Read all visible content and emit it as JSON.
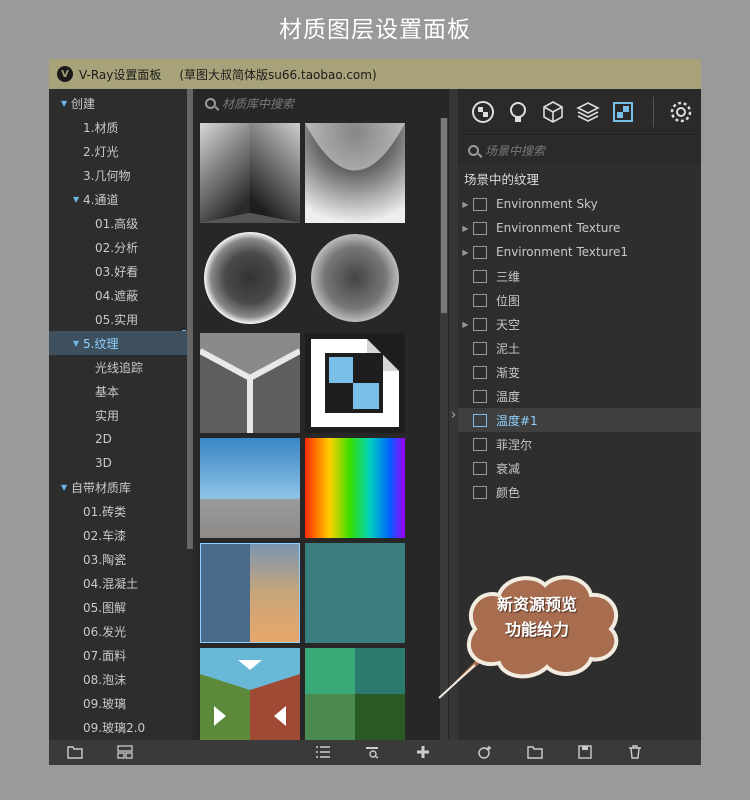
{
  "page_title": "材质图层设置面板",
  "window": {
    "logo": "V",
    "title": "V-Ray设置面板",
    "subtitle": "(草图大叔简体版su66.taobao.com)"
  },
  "tree": {
    "items": [
      {
        "label": "创建",
        "caret": "▼"
      },
      {
        "label": "1.材质"
      },
      {
        "label": "2.灯光"
      },
      {
        "label": "3.几何物"
      },
      {
        "label": "4.通道",
        "caret": "▼"
      },
      {
        "label": "01.高级"
      },
      {
        "label": "02.分析"
      },
      {
        "label": "03.好看"
      },
      {
        "label": "04.遮蔽"
      },
      {
        "label": "05.实用"
      },
      {
        "label": "5.纹理",
        "caret": "▼",
        "selected": true
      },
      {
        "label": "光线追踪"
      },
      {
        "label": "基本"
      },
      {
        "label": "实用"
      },
      {
        "label": "2D"
      },
      {
        "label": "3D"
      },
      {
        "label": "自带材质库",
        "caret": "▼"
      },
      {
        "label": "01.砖类"
      },
      {
        "label": "02.车漆"
      },
      {
        "label": "03.陶瓷"
      },
      {
        "label": "04.混凝土"
      },
      {
        "label": "05.图解"
      },
      {
        "label": "06.发光"
      },
      {
        "label": "07.面料"
      },
      {
        "label": "08.泡沫"
      },
      {
        "label": "09.玻璃"
      },
      {
        "label": "09.玻璃2.0"
      }
    ]
  },
  "library": {
    "search_placeholder": "材质库中搜索"
  },
  "right_panel": {
    "toolbar_icons": [
      "material-ball-icon",
      "light-bulb-icon",
      "geometry-cube-icon",
      "layers-icon",
      "texture-icon",
      "settings-gear-icon"
    ],
    "search_placeholder": "场景中搜索",
    "section_title": "场景中的纹理",
    "items": [
      {
        "label": "Environment Sky",
        "expandable": true
      },
      {
        "label": "Environment Texture",
        "expandable": true
      },
      {
        "label": "Environment Texture1",
        "expandable": true
      },
      {
        "label": "三维"
      },
      {
        "label": "位图"
      },
      {
        "label": "天空",
        "expandable": true
      },
      {
        "label": "泥土"
      },
      {
        "label": "渐变"
      },
      {
        "label": "温度"
      },
      {
        "label": "温度#1",
        "selected": true
      },
      {
        "label": "菲涅尔"
      },
      {
        "label": "衰减"
      },
      {
        "label": "颜色"
      }
    ]
  },
  "callout": {
    "line1": "新资源预览",
    "line2": "功能给力"
  },
  "colors": {
    "accent": "#7bbfe8",
    "titlebar": "#a8a27a",
    "callout_fill": "#a86c4f"
  }
}
